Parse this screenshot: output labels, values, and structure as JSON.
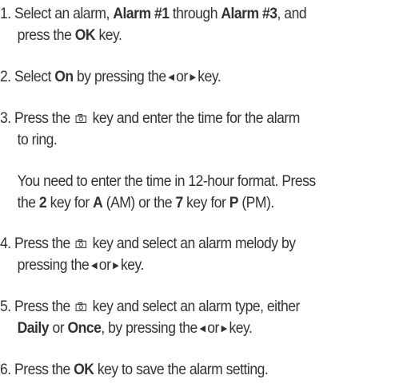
{
  "steps": [
    {
      "number": "1.",
      "t1": "Select an alarm,",
      "alarm1": "Alarm #1",
      "t2": "through",
      "alarm3": "Alarm #3",
      "t3": ", and",
      "t4": "press the",
      "ok": "OK",
      "t5": "key."
    },
    {
      "number": "2.",
      "t1": "Select",
      "on": "On",
      "t2": "by pressing the",
      "or": "or",
      "t3": "key."
    },
    {
      "number": "3.",
      "t1": "Press the",
      "t2": "key and enter the time for the alarm",
      "t3": "to ring.",
      "note_a": "You need to enter the time in 12-hour format. Press",
      "note_b1": "the",
      "key2": "2",
      "note_b2": "key for",
      "am_letter": "A",
      "note_b3": "(AM) or the",
      "key7": "7",
      "note_b4": "key for",
      "pm_letter": "P",
      "note_b5": "(PM)."
    },
    {
      "number": "4.",
      "t1": "Press the",
      "t2": "key and select an alarm melody by",
      "t3": "pressing the",
      "or": "or",
      "t4": "key."
    },
    {
      "number": "5.",
      "t1": "Press the",
      "t2": "key and select an alarm type, either",
      "daily": "Daily",
      "t3": "or",
      "once": "Once",
      "t4": ", by pressing the",
      "or": "or",
      "t5": "key."
    },
    {
      "number": "6.",
      "t1": "Press the",
      "ok": "OK",
      "t2": "key to save the alarm setting."
    }
  ],
  "icons": {
    "left": "left-arrow-icon",
    "right": "right-arrow-icon",
    "camera": "camera-key-icon"
  }
}
